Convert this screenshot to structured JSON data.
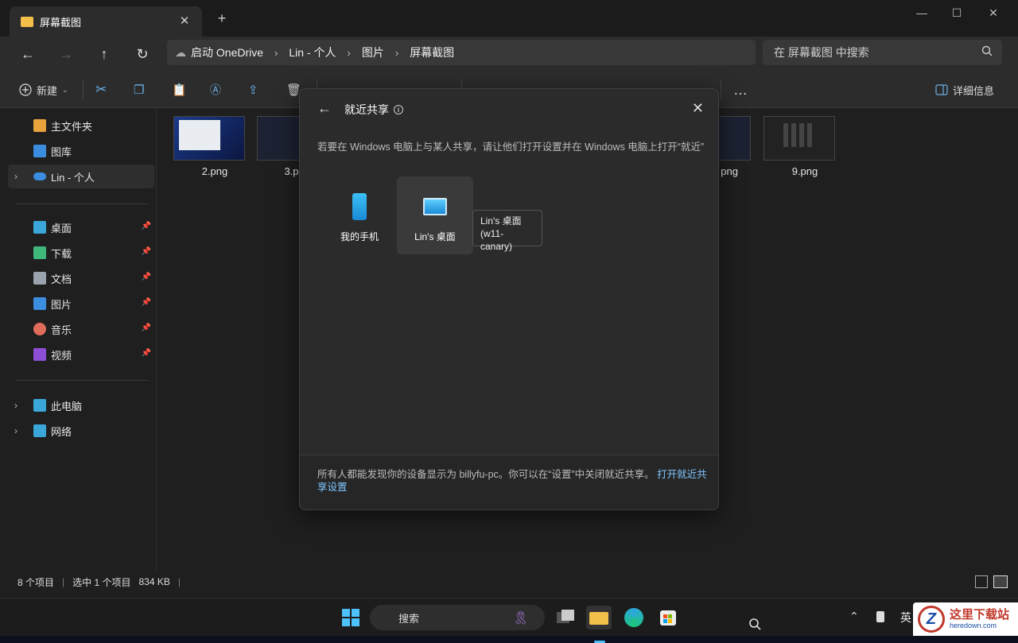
{
  "tab": {
    "title": "屏幕截图",
    "close": "✕",
    "new": "+"
  },
  "window": {
    "minimize": "—",
    "maximize": "☐",
    "close": "✕"
  },
  "breadcrumb": [
    "启动 OneDrive",
    "Lin - 个人",
    "图片",
    "屏幕截图"
  ],
  "search": {
    "placeholder": "在 屏幕截图 中搜索"
  },
  "toolbar": {
    "new_label": "新建",
    "details_label": "详细信息",
    "more": "…"
  },
  "sidebar": {
    "items": [
      {
        "label": "主文件夹",
        "icon": "home-icon",
        "color": "#e8a33d"
      },
      {
        "label": "图库",
        "icon": "gallery-icon",
        "color": "#3b8de0"
      },
      {
        "label": "Lin - 个人",
        "icon": "onedrive-icon",
        "color": "#3b8de0"
      }
    ],
    "pinned": [
      {
        "label": "桌面",
        "icon": "desktop-icon",
        "color": "#3aa7d8"
      },
      {
        "label": "下载",
        "icon": "download-icon",
        "color": "#3fb67a"
      },
      {
        "label": "文档",
        "icon": "document-icon",
        "color": "#9aa3ad"
      },
      {
        "label": "图片",
        "icon": "pictures-icon",
        "color": "#3b8de0"
      },
      {
        "label": "音乐",
        "icon": "music-icon",
        "color": "#e06d5b"
      },
      {
        "label": "视频",
        "icon": "video-icon",
        "color": "#8c4fd6"
      }
    ],
    "devices": [
      {
        "label": "此电脑",
        "icon": "pc-icon",
        "color": "#3aa7d8"
      },
      {
        "label": "网络",
        "icon": "network-icon",
        "color": "#3aa7d8"
      }
    ]
  },
  "files": [
    "2.png",
    "3.png",
    "png",
    "9.png"
  ],
  "status": {
    "count": "8 个项目",
    "selected": "选中 1 个项目",
    "size": "834 KB"
  },
  "dialog": {
    "title": "就近共享",
    "description": "若要在 Windows 电脑上与某人共享，请让他们打开设置并在 Windows 电脑上打开“就近”",
    "devices": [
      {
        "label": "我的手机",
        "icon": "phone-icon"
      },
      {
        "label": "Lin's 桌面",
        "icon": "monitor-icon"
      }
    ],
    "tooltip": {
      "line1": "Lin's 桌面",
      "line2": "(w11-canary)"
    },
    "footer_text": "所有人都能发现你的设备显示为 billyfu-pc。你可以在“设置”中关闭就近共享。",
    "footer_link": "打开就近共享设置"
  },
  "taskbar": {
    "search_label": "搜索",
    "ime": "英"
  },
  "watermark": {
    "title": "这里下载站",
    "url": "heredown.com"
  }
}
